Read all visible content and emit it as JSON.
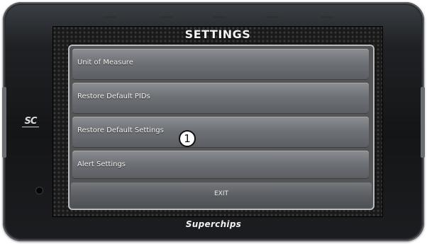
{
  "device": {
    "logo": "SC",
    "brand": "Superchips"
  },
  "screen": {
    "title": "SETTINGS",
    "menu_items": [
      {
        "label": "Unit of Measure"
      },
      {
        "label": "Restore Default PIDs"
      },
      {
        "label": "Restore Default Settings"
      },
      {
        "label": "Alert Settings"
      }
    ],
    "exit_label": "EXIT",
    "callout_number": "1"
  },
  "colors": {
    "bezel": "#141517",
    "menu_item": "#6e7175",
    "menu_border": "#b9bcc0",
    "text": "#f4f4f4"
  }
}
